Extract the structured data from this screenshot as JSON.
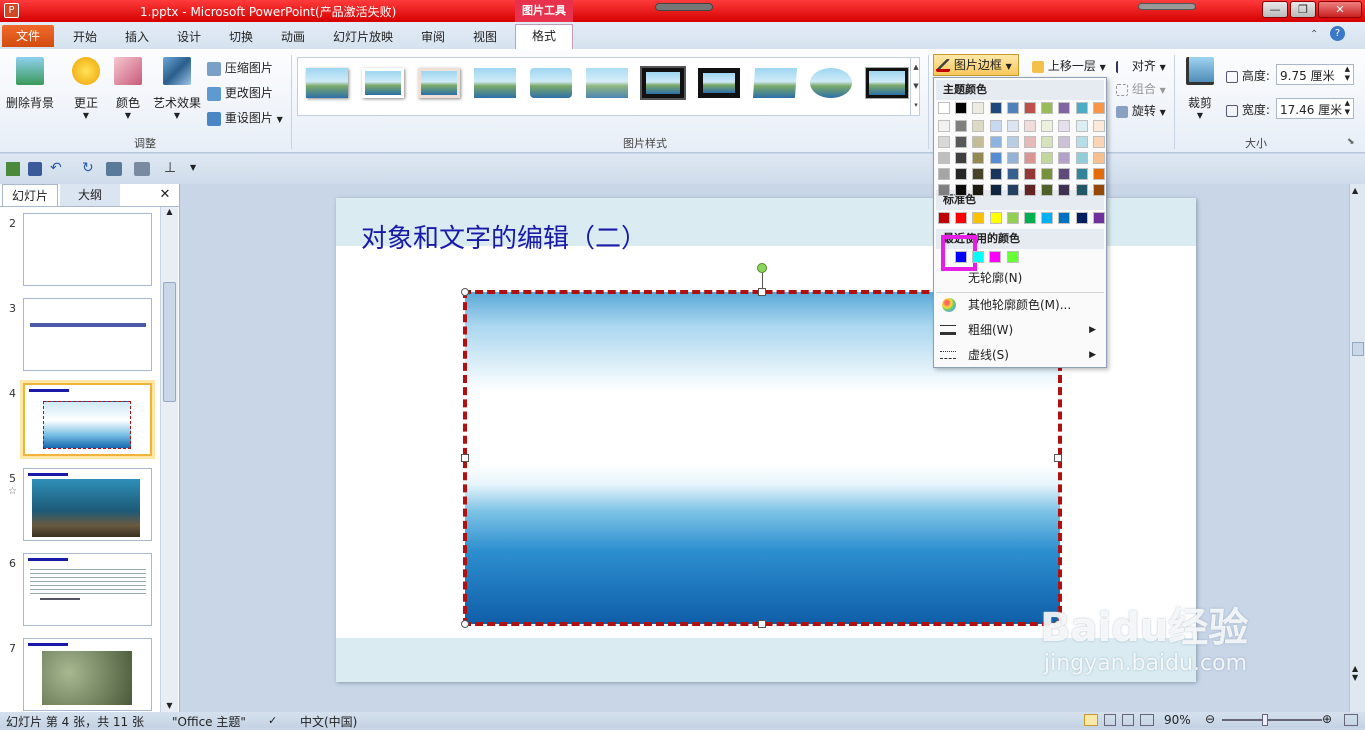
{
  "window": {
    "title": "1.pptx - Microsoft PowerPoint(产品激活失败)",
    "context_tab": "图片工具"
  },
  "tabs": [
    "文件",
    "开始",
    "插入",
    "设计",
    "切换",
    "动画",
    "幻灯片放映",
    "审阅",
    "视图",
    "格式"
  ],
  "ribbon": {
    "adjust": {
      "remove_bg": "删除背景",
      "corrections": "更正",
      "color": "颜色",
      "artistic": "艺术效果",
      "compress": "压缩图片",
      "change": "更改图片",
      "reset": "重设图片",
      "group_label": "调整"
    },
    "styles": {
      "group_label": "图片样式"
    },
    "arrange": {
      "border": "图片边框",
      "bring_forward": "上移一层",
      "align": "对齐",
      "group": "组合",
      "rotate": "旋转"
    },
    "size": {
      "crop": "裁剪",
      "height_label": "高度:",
      "height_value": "9.75 厘米",
      "width_label": "宽度:",
      "width_value": "17.46 厘米",
      "group_label": "大小"
    }
  },
  "left_pane": {
    "tab_slides": "幻灯片",
    "tab_outline": "大纲",
    "close": "✕",
    "slides": [
      {
        "num": "2"
      },
      {
        "num": "3"
      },
      {
        "num": "4"
      },
      {
        "num": "5"
      },
      {
        "num": "6"
      },
      {
        "num": "7"
      }
    ]
  },
  "slide": {
    "title": "对象和文字的编辑（二）"
  },
  "dropdown": {
    "theme_colors_heading": "主题颜色",
    "standard_colors_heading": "标准色",
    "recent_colors_heading": "最近使用的颜色",
    "no_outline": "无轮廓(N)",
    "more_colors": "其他轮廓颜色(M)...",
    "weight": "粗细(W)",
    "dashes": "虚线(S)",
    "theme_row": [
      "#ffffff",
      "#000000",
      "#eeece1",
      "#1f497d",
      "#4f81bd",
      "#c0504d",
      "#9bbb59",
      "#8064a2",
      "#4bacc6",
      "#f79646"
    ],
    "theme_shades": [
      [
        "#f2f2f2",
        "#7f7f7f",
        "#ddd9c3",
        "#c6d9f0",
        "#dbe5f1",
        "#f2dcdb",
        "#ebf1dd",
        "#e5e0ec",
        "#dbeef3",
        "#fdeada"
      ],
      [
        "#d8d8d8",
        "#595959",
        "#c4bd97",
        "#8db3e2",
        "#b8cce4",
        "#e5b9b7",
        "#d7e3bc",
        "#ccc1d9",
        "#b7dde8",
        "#fbd5b5"
      ],
      [
        "#bfbfbf",
        "#3f3f3f",
        "#938953",
        "#548dd4",
        "#95b3d7",
        "#d99694",
        "#c3d69b",
        "#b2a2c7",
        "#92cddc",
        "#fac08f"
      ],
      [
        "#a5a5a5",
        "#262626",
        "#494429",
        "#17365d",
        "#366092",
        "#953734",
        "#76923c",
        "#5f497a",
        "#31859b",
        "#e36c09"
      ],
      [
        "#7f7f7f",
        "#0c0c0c",
        "#1d1b10",
        "#0f243e",
        "#244061",
        "#632423",
        "#4f6128",
        "#3f3151",
        "#205867",
        "#974806"
      ]
    ],
    "standard_colors": [
      "#c00000",
      "#ff0000",
      "#ffc000",
      "#ffff00",
      "#92d050",
      "#00b050",
      "#00b0f0",
      "#0070c0",
      "#002060",
      "#7030a0"
    ],
    "recent_colors": [
      "#0000ff",
      "#00ffff",
      "#ff00ff",
      "#66ff33"
    ],
    "highlight_color": "#e61ee6"
  },
  "status": {
    "slide_info": "幻灯片 第 4 张，共 11 张",
    "theme": "\"Office 主题\"",
    "language": "中文(中国)",
    "zoom": "90%"
  },
  "watermark": {
    "brand": "Baidu经验",
    "url": "jingyan.baidu.com"
  }
}
